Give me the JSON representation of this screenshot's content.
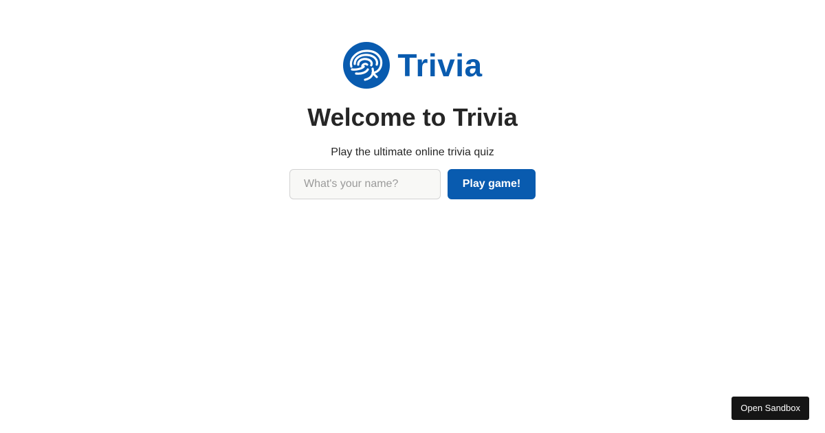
{
  "brand": {
    "name": "Trivia",
    "logo_icon": "brain-icon",
    "color": "#095baf"
  },
  "hero": {
    "title": "Welcome to Trivia",
    "subtitle": "Play the ultimate online trivia quiz"
  },
  "form": {
    "name_input": {
      "value": "",
      "placeholder": "What's your name?"
    },
    "play_label": "Play game!"
  },
  "sandbox": {
    "label": "Open Sandbox",
    "color": "#151515"
  }
}
